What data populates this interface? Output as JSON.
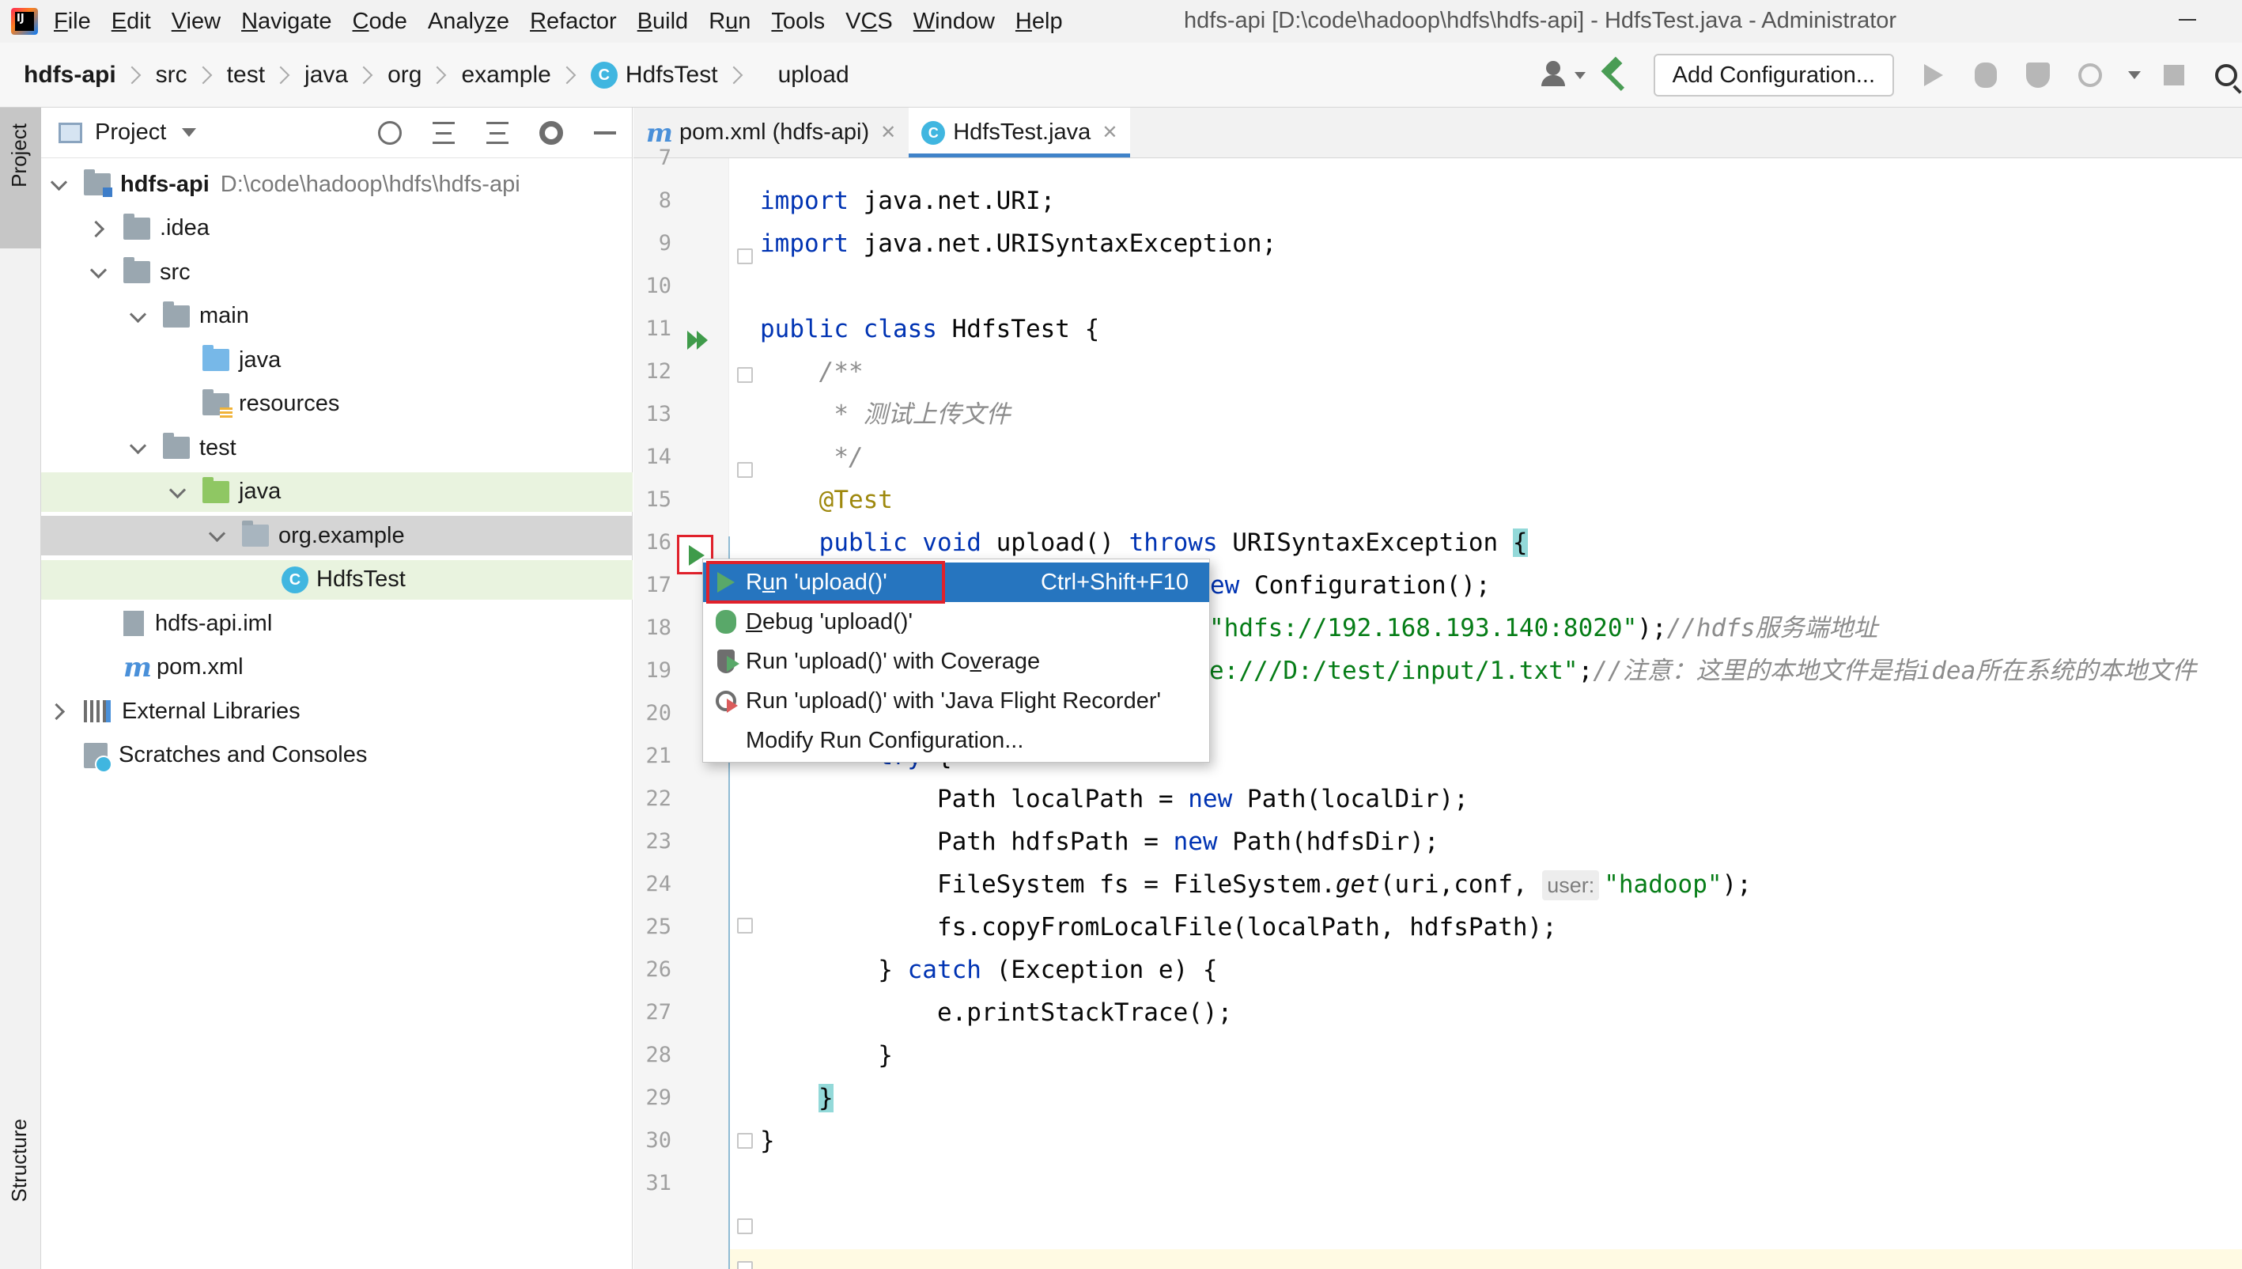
{
  "menubar": {
    "items": [
      {
        "label": "File",
        "u": "F",
        "rest": "ile"
      },
      {
        "label": "Edit",
        "u": "E",
        "rest": "dit"
      },
      {
        "label": "View",
        "u": "V",
        "rest": "iew"
      },
      {
        "label": "Navigate",
        "u": "N",
        "rest": "avigate"
      },
      {
        "label": "Code",
        "u": "C",
        "rest": "ode"
      },
      {
        "label": "Analyze",
        "pre": "Analy",
        "u": "z",
        "rest": "e"
      },
      {
        "label": "Refactor",
        "u": "R",
        "rest": "efactor"
      },
      {
        "label": "Build",
        "u": "B",
        "rest": "uild"
      },
      {
        "label": "Run",
        "pre": "R",
        "u": "u",
        "rest": "n"
      },
      {
        "label": "Tools",
        "u": "T",
        "rest": "ools"
      },
      {
        "label": "VCS",
        "pre": "V",
        "u": "C",
        "rest": "S"
      },
      {
        "label": "Window",
        "u": "W",
        "rest": "indow"
      },
      {
        "label": "Help",
        "u": "H",
        "rest": "elp"
      }
    ],
    "window_title": "hdfs-api [D:\\code\\hadoop\\hdfs\\hdfs-api] - HdfsTest.java - Administrator"
  },
  "breadcrumb": [
    "hdfs-api",
    "src",
    "test",
    "java",
    "org",
    "example",
    "HdfsTest",
    "upload"
  ],
  "toolbar": {
    "add_configuration": "Add Configuration..."
  },
  "left_strip": {
    "project": "Project",
    "structure": "Structure"
  },
  "project_panel": {
    "title": "Project",
    "root_path": "D:\\code\\hadoop\\hdfs\\hdfs-api",
    "tree": [
      {
        "label": "hdfs-api",
        "depth": 0,
        "toggle": "open",
        "icon": "module-folder",
        "bold": true
      },
      {
        "label": ".idea",
        "depth": 1,
        "toggle": "closed",
        "icon": "folder"
      },
      {
        "label": "src",
        "depth": 1,
        "toggle": "open",
        "icon": "folder"
      },
      {
        "label": "main",
        "depth": 2,
        "toggle": "open",
        "icon": "folder"
      },
      {
        "label": "java",
        "depth": 3,
        "toggle": "none",
        "icon": "source-folder"
      },
      {
        "label": "resources",
        "depth": 3,
        "toggle": "none",
        "icon": "resources-folder"
      },
      {
        "label": "test",
        "depth": 2,
        "toggle": "open",
        "icon": "folder"
      },
      {
        "label": "java",
        "depth": 3,
        "toggle": "open",
        "icon": "test-folder",
        "highlight": "green"
      },
      {
        "label": "org.example",
        "depth": 4,
        "toggle": "open",
        "icon": "package-folder",
        "highlight": "grey"
      },
      {
        "label": "HdfsTest",
        "depth": 5,
        "toggle": "none",
        "icon": "class",
        "highlight": "green"
      },
      {
        "label": "hdfs-api.iml",
        "depth": 1,
        "toggle": "none",
        "icon": "iml-file"
      },
      {
        "label": "pom.xml",
        "depth": 1,
        "toggle": "none",
        "icon": "maven-file"
      },
      {
        "label": "External Libraries",
        "depth": 0,
        "toggle": "closed",
        "icon": "library"
      },
      {
        "label": "Scratches and Consoles",
        "depth": 0,
        "toggle": "none",
        "icon": "scratch"
      }
    ]
  },
  "tabs": [
    {
      "label": "pom.xml (hdfs-api)",
      "icon": "maven-icon",
      "active": false
    },
    {
      "label": "HdfsTest.java",
      "icon": "class-icon",
      "active": true
    }
  ],
  "editor": {
    "line_numbers": [
      "7",
      "8",
      "9",
      "10",
      "11",
      "12",
      "13",
      "14",
      "15",
      "16",
      "17",
      "18",
      "19",
      "20",
      "21",
      "22",
      "23",
      "24",
      "25",
      "26",
      "27",
      "28",
      "29",
      "30",
      "31"
    ],
    "lines": {
      "l8": {
        "kw": "import",
        "rest": " java.net.URI;"
      },
      "l9": {
        "kw": "import",
        "rest": " java.net.URISyntaxException;"
      },
      "l11": {
        "kw1": "public",
        "kw2": "class",
        "rest": " HdfsTest {"
      },
      "l12": "    /**",
      "l13": "     * 测试上传文件",
      "l14": "     */",
      "l15": "    @Test",
      "l16": {
        "indent": "    ",
        "kw1": "public",
        "kw2": "void",
        "name": "upload",
        "paren": "() ",
        "kw3": "throws",
        "rest": " URISyntaxException ",
        "brace": "{"
      },
      "l17": {
        "kw": "ew",
        "rest": " Configuration();"
      },
      "l18": {
        "str": "\"hdfs://192.168.193.140:8020\"",
        "rest": ");",
        "cm": "//hdfs服务端地址"
      },
      "l19": {
        "str": "e:///D:/test/input/1.txt\"",
        "rest": ";",
        "cm": "//注意：这里的本地文件是指idea所在系统的本地文件"
      },
      "l21": {
        "indent": "        ",
        "kw": "try",
        "rest": " {"
      },
      "l22": {
        "pre": "            Path localPath = ",
        "kw": "new",
        "rest": " Path(localDir);"
      },
      "l23": {
        "pre": "            Path hdfsPath = ",
        "kw": "new",
        "rest": " Path(hdfsDir);"
      },
      "l24": {
        "pre": "            FileSystem fs = FileSystem.",
        "it": "get",
        "mid": "(uri,conf, ",
        "hint": "user:",
        "str": "\"hadoop\"",
        "rest": ");"
      },
      "l25": "            fs.copyFromLocalFile(localPath, hdfsPath);",
      "l26": {
        "pre": "        } ",
        "kw": "catch",
        "rest": " (Exception e) {"
      },
      "l27": "            e.printStackTrace();",
      "l28": "        }",
      "l29": "}",
      "l30": "}"
    }
  },
  "popup_menu": {
    "items": [
      {
        "pre": "R",
        "u": "u",
        "rest": "n 'upload()'",
        "shortcut": "Ctrl+Shift+F10",
        "selected": true
      },
      {
        "pre": "",
        "u": "D",
        "rest": "ebug 'upload()'",
        "shortcut": ""
      },
      {
        "pre": "Run 'upload()' with Co",
        "u": "v",
        "rest": "erage",
        "shortcut": ""
      },
      {
        "pre": "Run 'upload()' with 'Java Flight Recorder'",
        "u": "",
        "rest": "",
        "shortcut": ""
      },
      {
        "pre": "Modify Run Configuration...",
        "u": "",
        "rest": "",
        "shortcut": ""
      }
    ]
  },
  "colors": {
    "keyword": "#0033b3",
    "string": "#067d17",
    "comment": "#8c8c8c",
    "annotation": "#9e880d",
    "selection": "#2675bf",
    "highlight_box": "#e0212b",
    "run_green": "#3f9b4a"
  }
}
